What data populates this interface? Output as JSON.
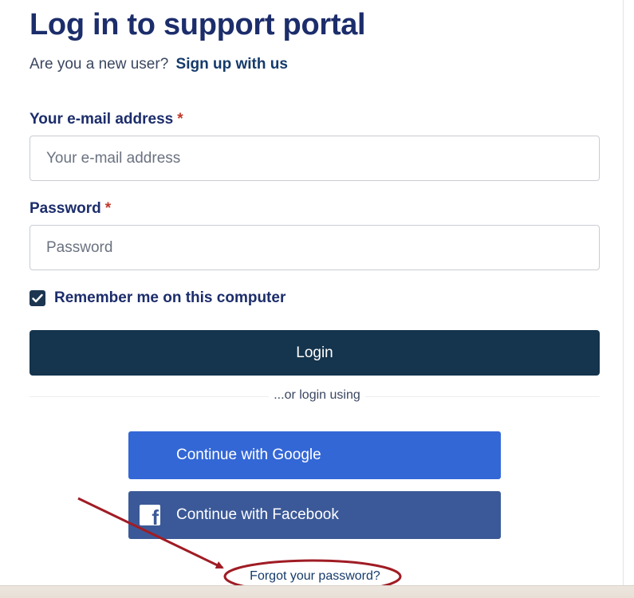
{
  "header": {
    "title": "Log in to support portal",
    "subtitle_text": "Are you a new user?",
    "signup_link": "Sign up with us"
  },
  "form": {
    "email": {
      "label": "Your e-mail address",
      "required_mark": "*",
      "placeholder": "Your e-mail address",
      "value": ""
    },
    "password": {
      "label": "Password",
      "required_mark": "*",
      "placeholder": "Password",
      "value": ""
    },
    "remember": {
      "label": "Remember me on this computer",
      "checked": true
    },
    "login_label": "Login"
  },
  "alt_login": {
    "divider_text": "...or login using",
    "google_label": "Continue with Google",
    "facebook_label": "Continue with Facebook"
  },
  "forgot_link": "Forgot your password?",
  "colors": {
    "title": "#1c2d6b",
    "login_button": "#15344d",
    "google_button": "#3367d6",
    "facebook_button": "#3b5998",
    "annotation": "#a01c24",
    "required": "#c0392b"
  },
  "icons": [
    "check-icon",
    "facebook-icon",
    "arrow-annotation",
    "ellipse-annotation"
  ]
}
